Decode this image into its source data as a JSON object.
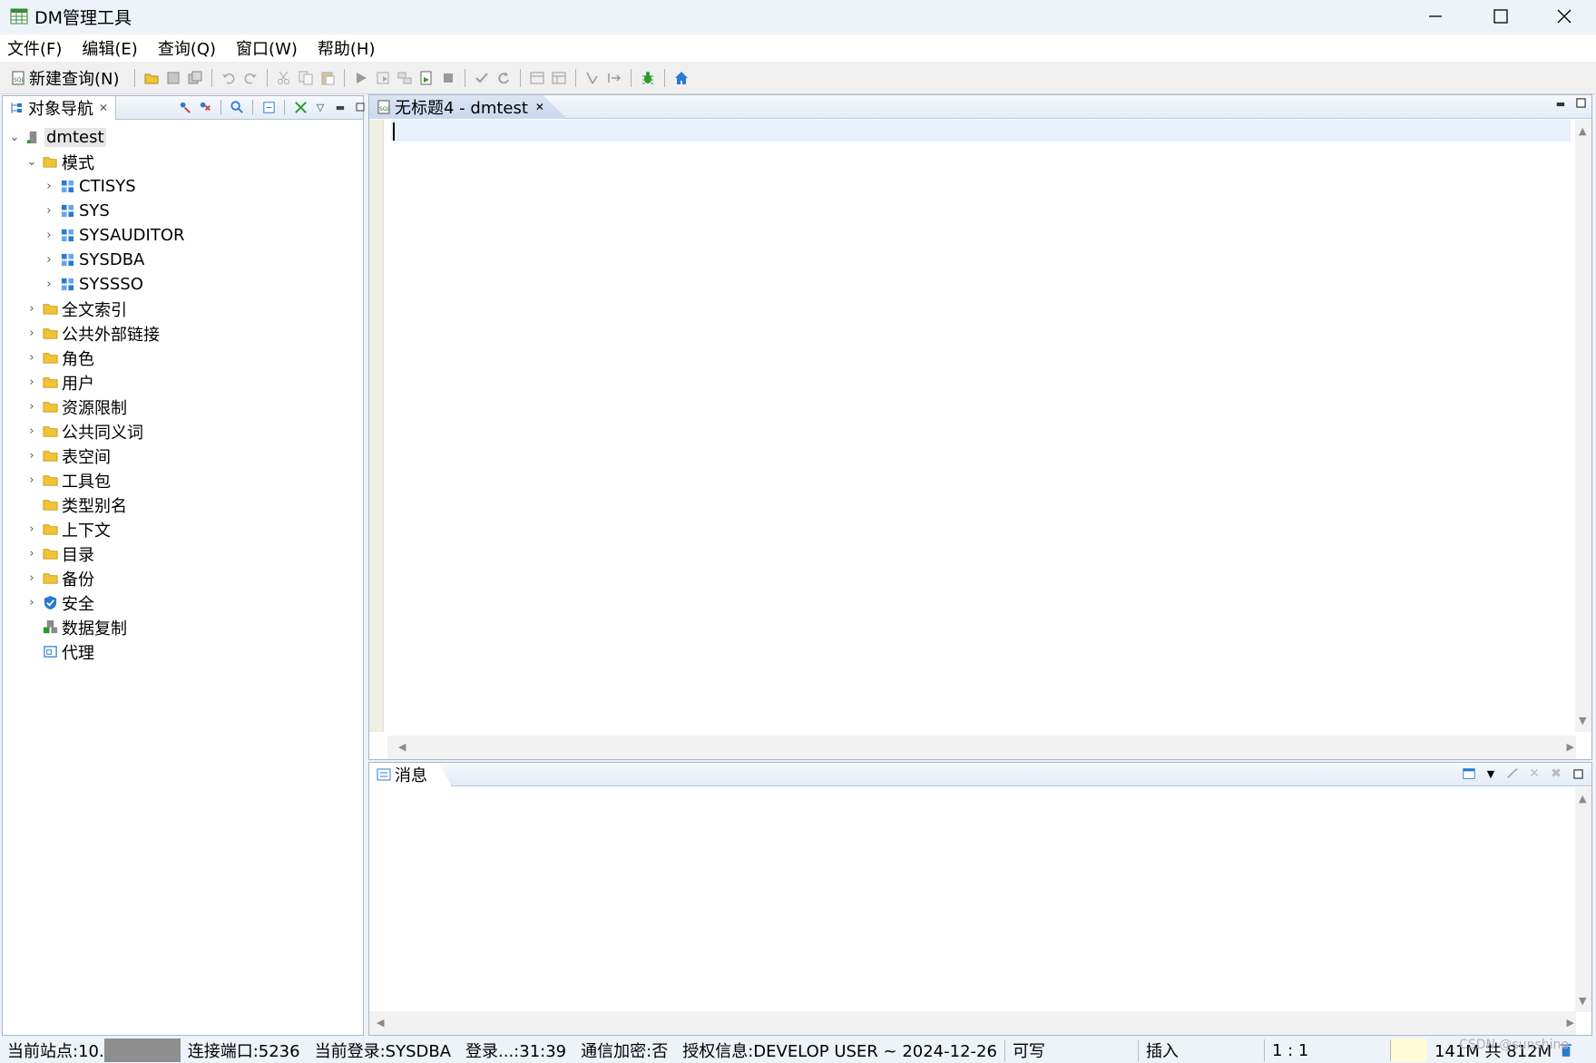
{
  "window": {
    "title": "DM管理工具",
    "minimize_icon": "minimize-icon",
    "maximize_icon": "maximize-icon",
    "close_icon": "close-icon"
  },
  "menu": [
    "文件(F)",
    "编辑(E)",
    "查询(Q)",
    "窗口(W)",
    "帮助(H)"
  ],
  "toolbar": {
    "new_query_label": "新建查询(N)"
  },
  "navigator": {
    "tab_label": "对象导航",
    "tree": {
      "root": "dmtest",
      "schemas_folder": "模式",
      "schemas": [
        "CTISYS",
        "SYS",
        "SYSAUDITOR",
        "SYSDBA",
        "SYSSSO"
      ],
      "folders": [
        "全文索引",
        "公共外部链接",
        "角色",
        "用户",
        "资源限制",
        "公共同义词",
        "表空间",
        "工具包",
        "类型别名",
        "上下文",
        "目录",
        "备份",
        "安全",
        "数据复制",
        "代理"
      ]
    }
  },
  "editor": {
    "tab_label": "无标题4 - dmtest"
  },
  "messages": {
    "tab_label": "消息"
  },
  "statusbar": {
    "site": "当前站点:10.",
    "port": "连接端口:5236",
    "login": "当前登录:SYSDBA",
    "login_time": "登录...:31:39",
    "encryption": "通信加密:否",
    "license": "授权信息:DEVELOP USER ~ 2024-12-26",
    "mode": "可写",
    "insert_mode": "插入",
    "position": "1 : 1",
    "memory": "141M 共 812M"
  },
  "watermark": "CSDN @sunshine"
}
